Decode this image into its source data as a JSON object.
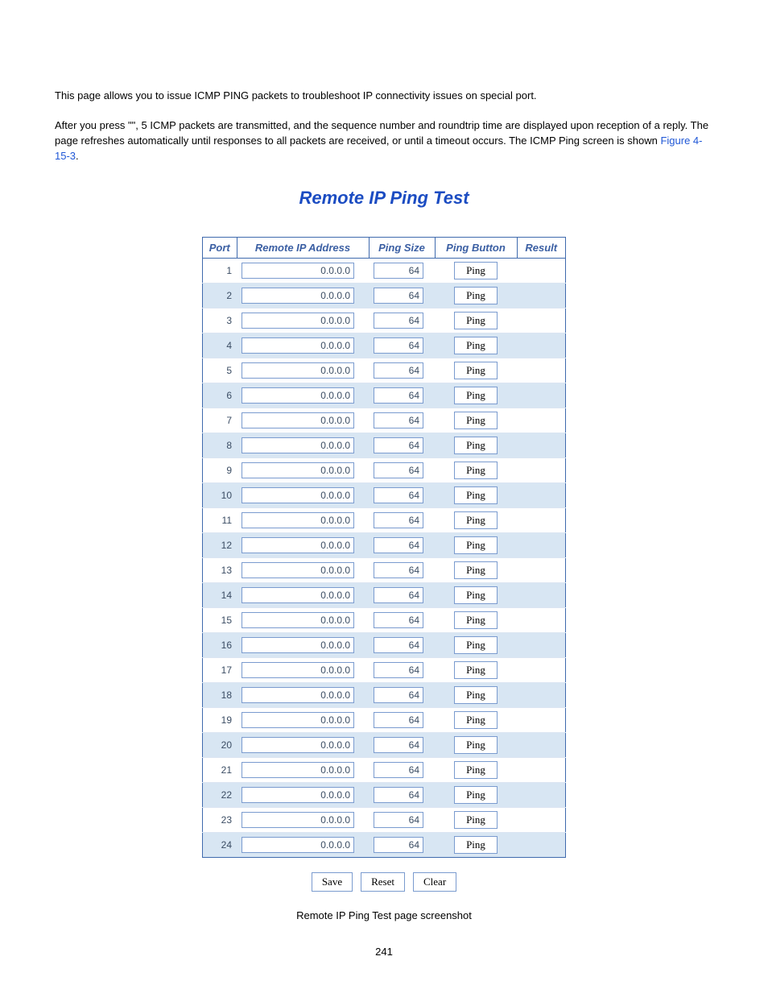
{
  "intro": {
    "line1": "This page allows you to issue ICMP PING packets to troubleshoot IP connectivity issues on special port.",
    "line2a": "After you press \"",
    "line2b": "\", 5 ICMP packets are transmitted, and the sequence number and roundtrip time are displayed upon reception of a reply. The page refreshes automatically until responses to all packets are received, or until a timeout occurs. The ICMP Ping screen is shown ",
    "figref": "Figure 4-15-3",
    "line2c": "."
  },
  "panel": {
    "title": "Remote IP Ping Test",
    "headers": {
      "port": "Port",
      "ip": "Remote IP Address",
      "size": "Ping Size",
      "button": "Ping Button",
      "result": "Result"
    },
    "ping_button_label": "Ping",
    "rows": [
      {
        "port": "1",
        "ip": "0.0.0.0",
        "size": "64",
        "result": ""
      },
      {
        "port": "2",
        "ip": "0.0.0.0",
        "size": "64",
        "result": ""
      },
      {
        "port": "3",
        "ip": "0.0.0.0",
        "size": "64",
        "result": ""
      },
      {
        "port": "4",
        "ip": "0.0.0.0",
        "size": "64",
        "result": ""
      },
      {
        "port": "5",
        "ip": "0.0.0.0",
        "size": "64",
        "result": ""
      },
      {
        "port": "6",
        "ip": "0.0.0.0",
        "size": "64",
        "result": ""
      },
      {
        "port": "7",
        "ip": "0.0.0.0",
        "size": "64",
        "result": ""
      },
      {
        "port": "8",
        "ip": "0.0.0.0",
        "size": "64",
        "result": ""
      },
      {
        "port": "9",
        "ip": "0.0.0.0",
        "size": "64",
        "result": ""
      },
      {
        "port": "10",
        "ip": "0.0.0.0",
        "size": "64",
        "result": ""
      },
      {
        "port": "11",
        "ip": "0.0.0.0",
        "size": "64",
        "result": ""
      },
      {
        "port": "12",
        "ip": "0.0.0.0",
        "size": "64",
        "result": ""
      },
      {
        "port": "13",
        "ip": "0.0.0.0",
        "size": "64",
        "result": ""
      },
      {
        "port": "14",
        "ip": "0.0.0.0",
        "size": "64",
        "result": ""
      },
      {
        "port": "15",
        "ip": "0.0.0.0",
        "size": "64",
        "result": ""
      },
      {
        "port": "16",
        "ip": "0.0.0.0",
        "size": "64",
        "result": ""
      },
      {
        "port": "17",
        "ip": "0.0.0.0",
        "size": "64",
        "result": ""
      },
      {
        "port": "18",
        "ip": "0.0.0.0",
        "size": "64",
        "result": ""
      },
      {
        "port": "19",
        "ip": "0.0.0.0",
        "size": "64",
        "result": ""
      },
      {
        "port": "20",
        "ip": "0.0.0.0",
        "size": "64",
        "result": ""
      },
      {
        "port": "21",
        "ip": "0.0.0.0",
        "size": "64",
        "result": ""
      },
      {
        "port": "22",
        "ip": "0.0.0.0",
        "size": "64",
        "result": ""
      },
      {
        "port": "23",
        "ip": "0.0.0.0",
        "size": "64",
        "result": ""
      },
      {
        "port": "24",
        "ip": "0.0.0.0",
        "size": "64",
        "result": ""
      }
    ],
    "buttons": {
      "save": "Save",
      "reset": "Reset",
      "clear": "Clear"
    }
  },
  "caption": "Remote IP Ping Test page screenshot",
  "page_number": "241"
}
